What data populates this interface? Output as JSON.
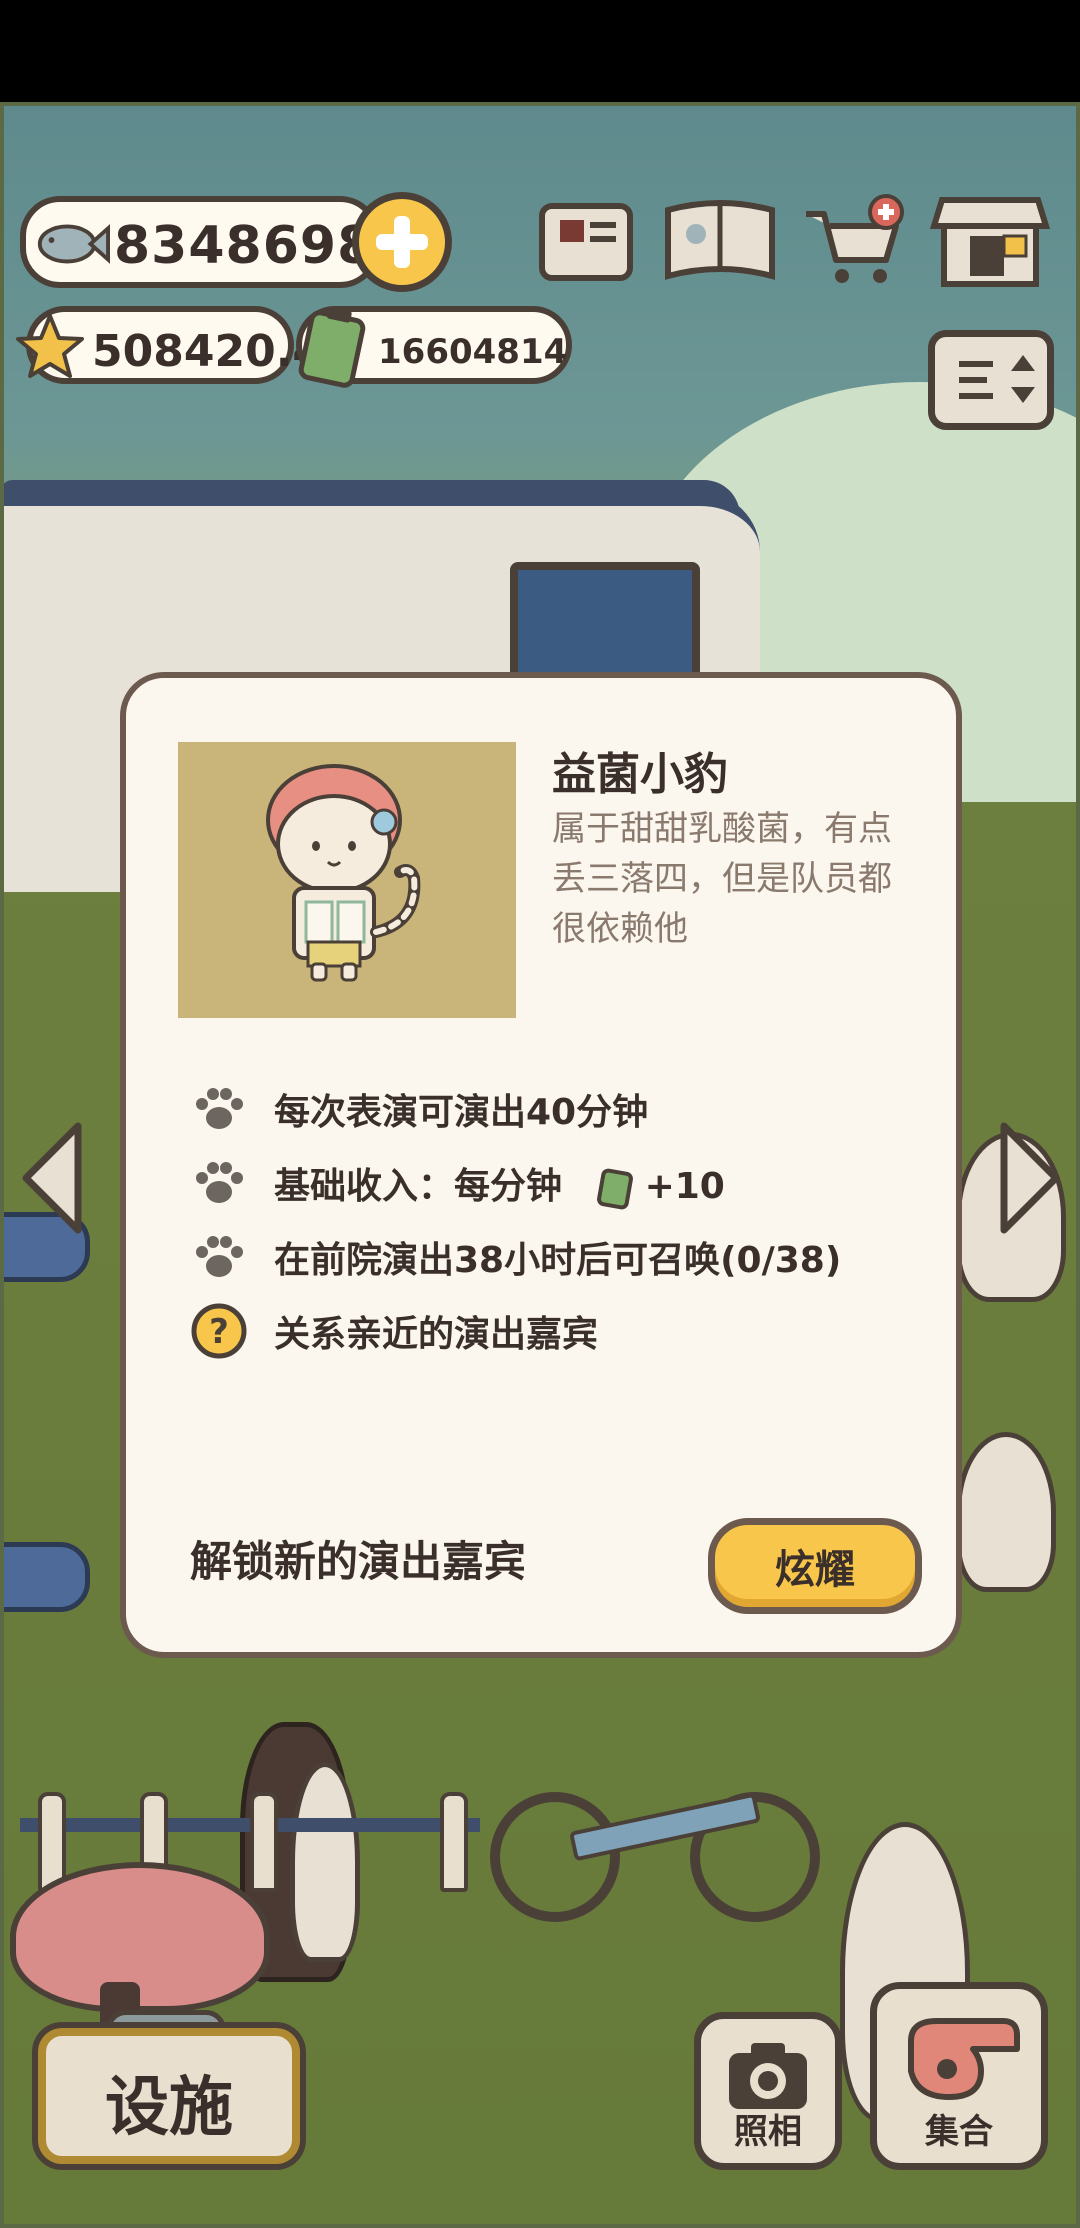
{
  "hud": {
    "fish_currency": "8348698",
    "star_currency": "508420.4",
    "battery_currency": "16604814",
    "icons": [
      "fish-icon",
      "plus-icon",
      "star-icon",
      "battery-icon",
      "newspaper-icon",
      "album-icon",
      "shopping-cart-icon",
      "shop-icon",
      "sort-icon"
    ]
  },
  "dialog": {
    "title": "益菌小豹",
    "description": "属于甜甜乳酸菌，有点丢三落四，但是队员都很依赖他",
    "info": [
      {
        "icon": "paw-icon",
        "text": "每次表演可演出40分钟"
      },
      {
        "icon": "paw-icon",
        "text_prefix": "基础收入：每分钟",
        "text_suffix": "+10"
      },
      {
        "icon": "paw-icon",
        "text": "在前院演出38小时后可召唤(0/38)"
      },
      {
        "icon": "question-icon",
        "text": "关系亲近的演出嘉宾"
      }
    ],
    "unlock_label": "解锁新的演出嘉宾",
    "show_button": "炫耀"
  },
  "bottom": {
    "facility_label": "设施",
    "camera_label": "照相",
    "gather_label": "集合"
  },
  "colors": {
    "accent_yellow": "#f7c64a",
    "outline_brown": "#4b4037",
    "dialog_bg": "#fbf6ee",
    "portrait_bg": "#c9b57a"
  }
}
